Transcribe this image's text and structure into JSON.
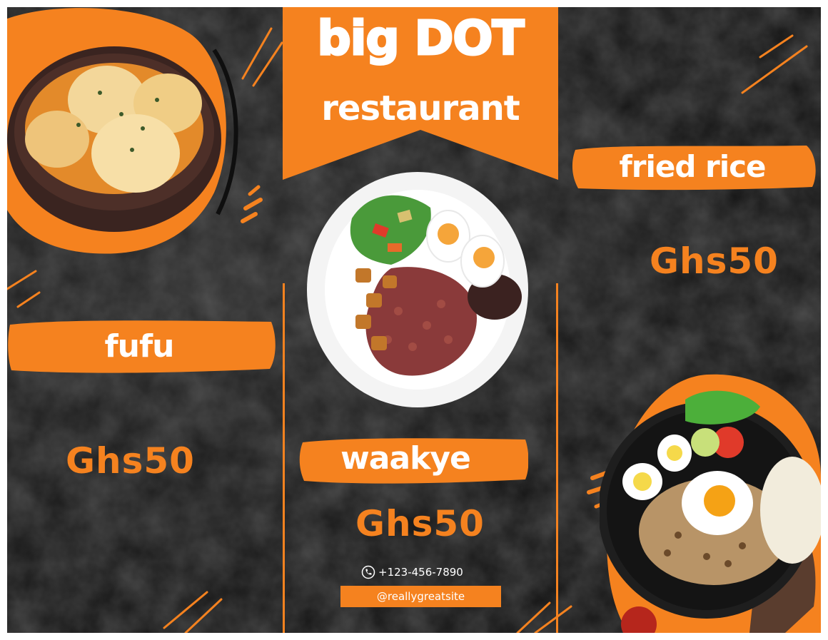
{
  "restaurant": {
    "name": "big DOT",
    "subtitle": "restaurant"
  },
  "menu": [
    {
      "name": "fufu",
      "price": "Ghs50"
    },
    {
      "name": "waakye",
      "price": "Ghs50"
    },
    {
      "name": "fried rice",
      "price": "Ghs50"
    }
  ],
  "contact": {
    "phone": "+123-456-7890",
    "website": "@reallygreatsite"
  },
  "icons": {
    "phone": "phone-icon"
  },
  "colors": {
    "accent": "#f5821f",
    "background": "#141414",
    "text": "#ffffff"
  }
}
